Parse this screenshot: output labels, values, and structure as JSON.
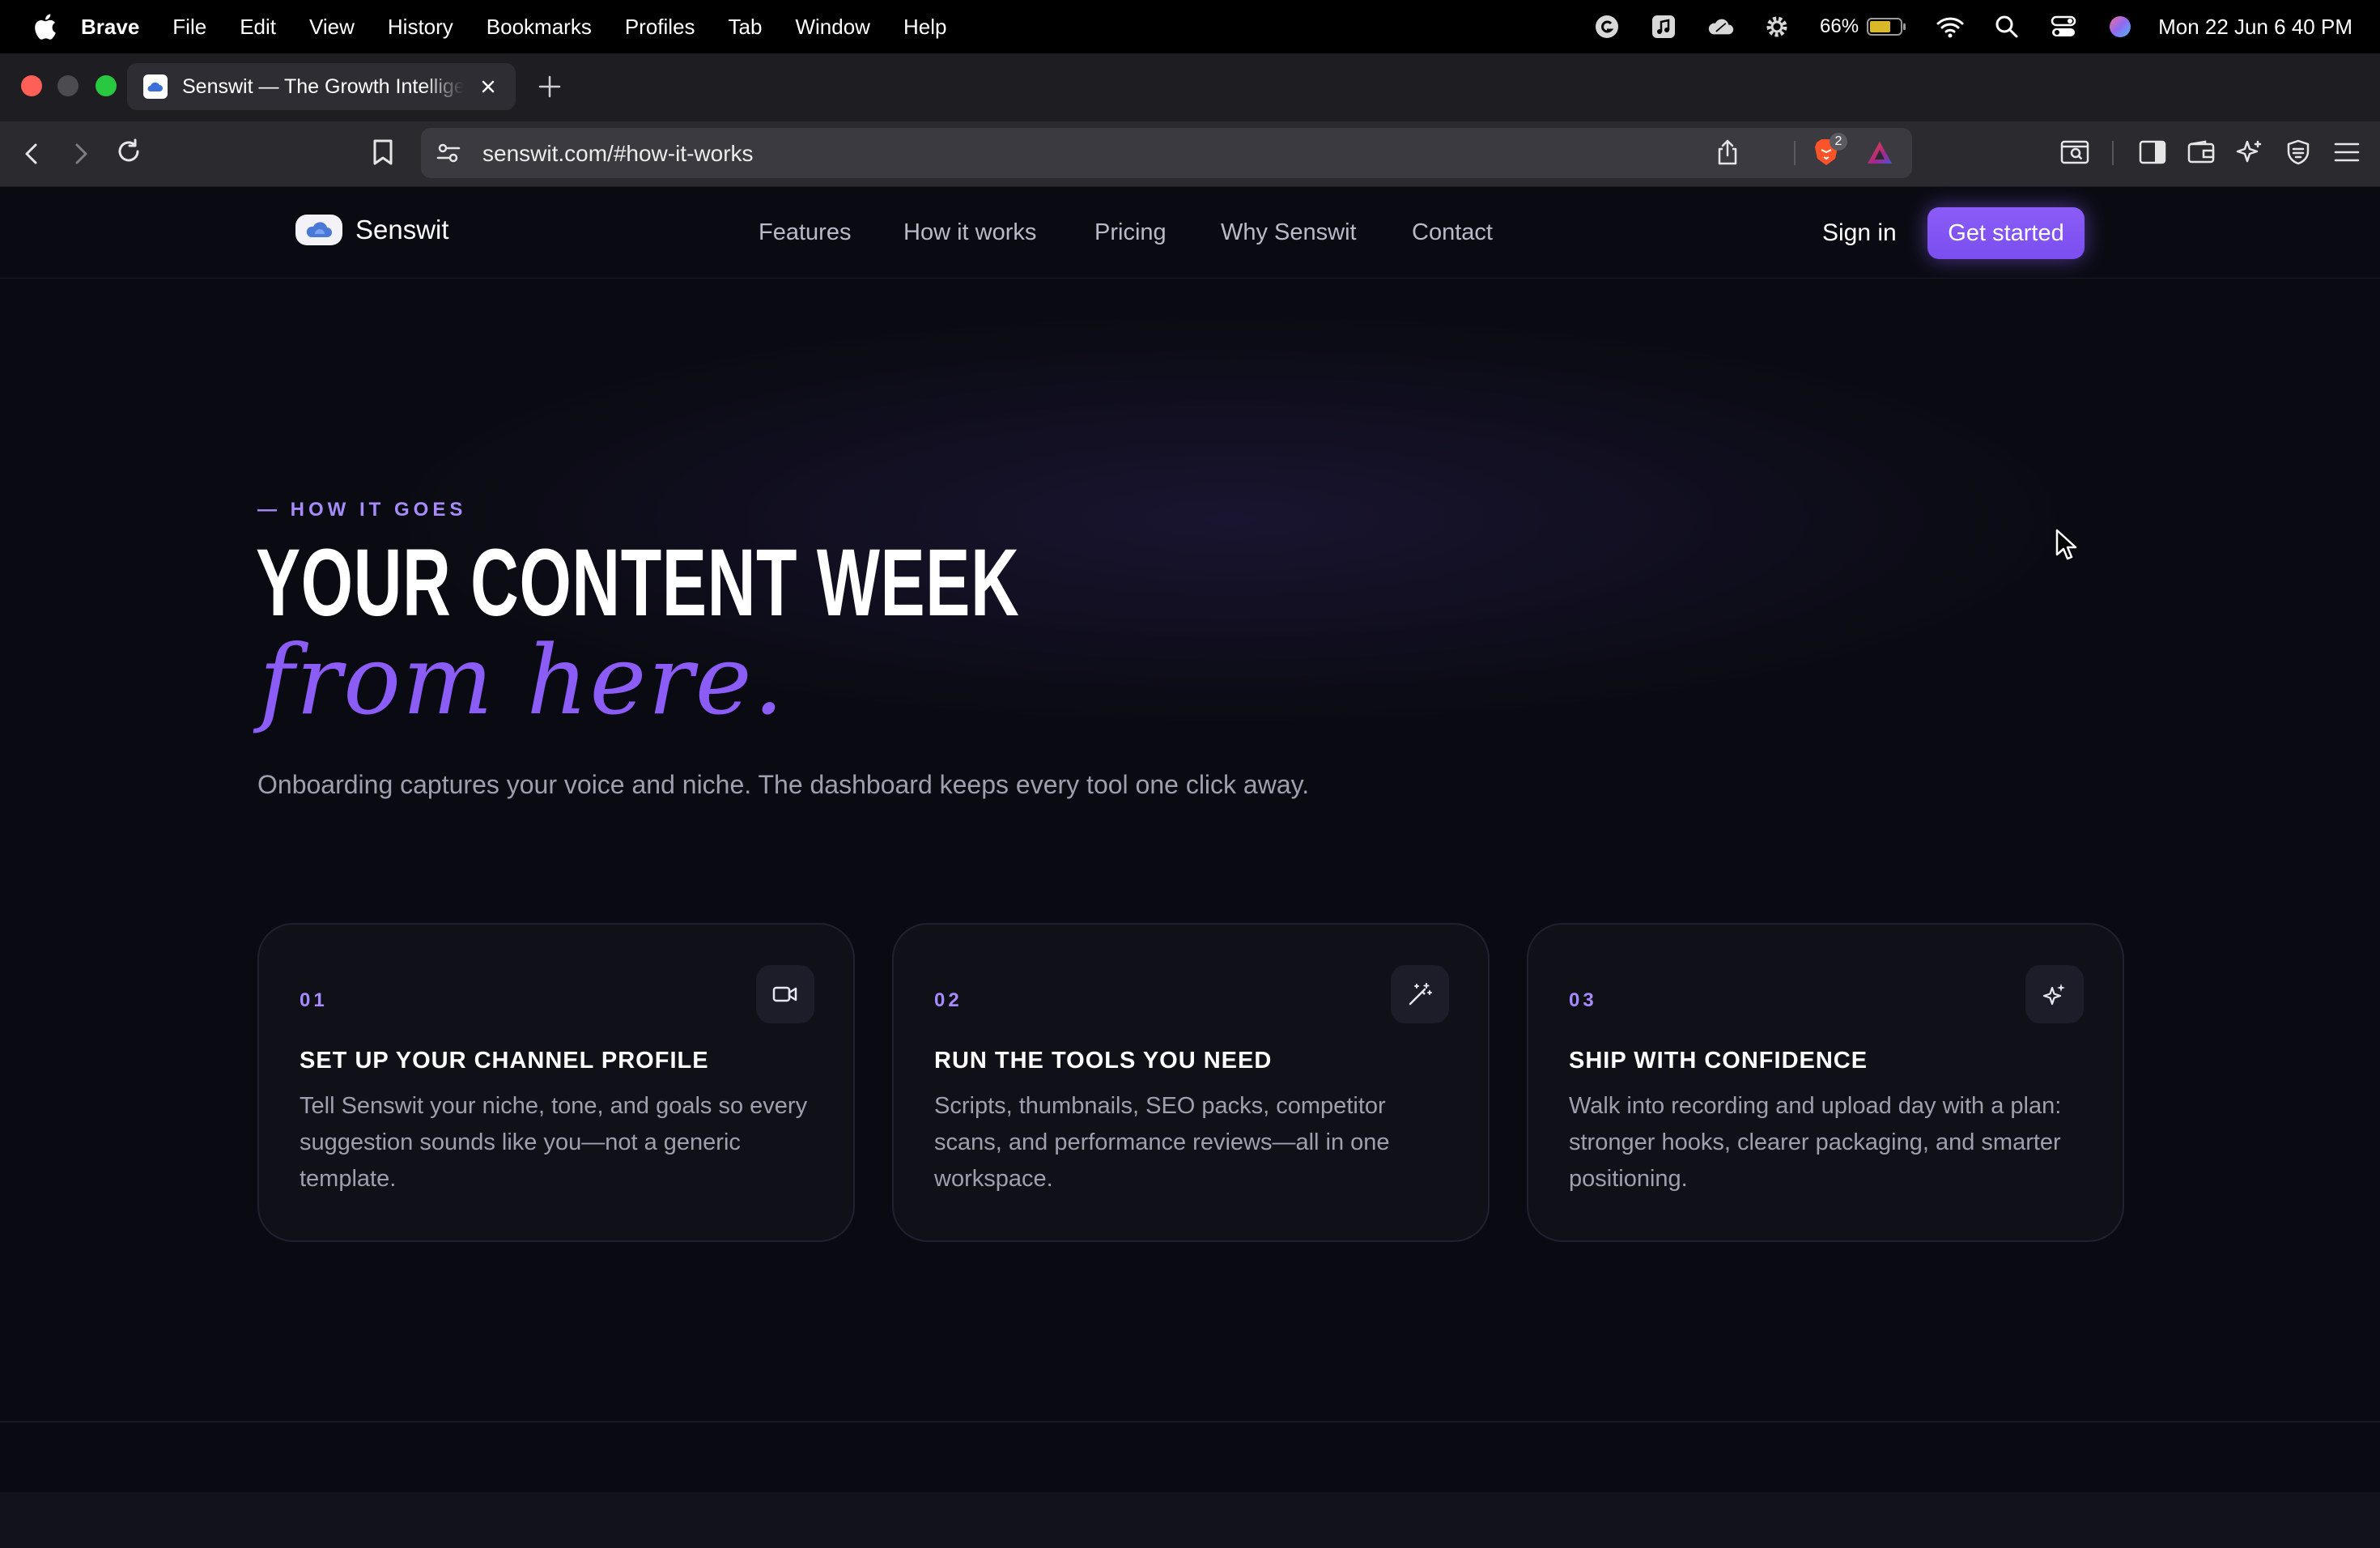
{
  "menubar": {
    "app": "Brave",
    "items": [
      "File",
      "Edit",
      "View",
      "History",
      "Bookmarks",
      "Profiles",
      "Tab",
      "Window",
      "Help"
    ],
    "battery_percent": "66%",
    "clock": "Mon 22 Jun  6 40 PM"
  },
  "tab": {
    "title": "Senswit — The Growth Intelligence",
    "new_tab_icon": "plus-icon"
  },
  "toolbar": {
    "url": "senswit.com/#how-it-works",
    "shields_count": "2"
  },
  "site": {
    "brand": "Senswit",
    "nav": [
      "Features",
      "How it works",
      "Pricing",
      "Why Senswit",
      "Contact"
    ],
    "sign_in": "Sign in",
    "cta": "Get started"
  },
  "hero": {
    "eyebrow": "— HOW IT GOES",
    "headline": "YOUR CONTENT WEEK",
    "script": "from here.",
    "lede": "Onboarding captures your voice and niche. The dashboard keeps every tool one click away."
  },
  "steps": [
    {
      "number": "01",
      "icon": "video-camera-icon",
      "title": "SET UP YOUR CHANNEL PROFILE",
      "text": "Tell Senswit your niche, tone, and goals so every suggestion sounds like you—not a generic template."
    },
    {
      "number": "02",
      "icon": "magic-wand-icon",
      "title": "RUN THE TOOLS YOU NEED",
      "text": "Scripts, thumbnails, SEO packs, competitor scans, and performance reviews—all in one workspace."
    },
    {
      "number": "03",
      "icon": "sparkles-icon",
      "title": "SHIP WITH CONFIDENCE",
      "text": "Walk into recording and upload day with a plan: stronger hooks, clearer packaging, and smarter positioning."
    }
  ],
  "colors": {
    "accent": "#8b5cf6",
    "accent_light": "#a78bfa",
    "background": "#0a0b12",
    "card": "#0f1018"
  }
}
